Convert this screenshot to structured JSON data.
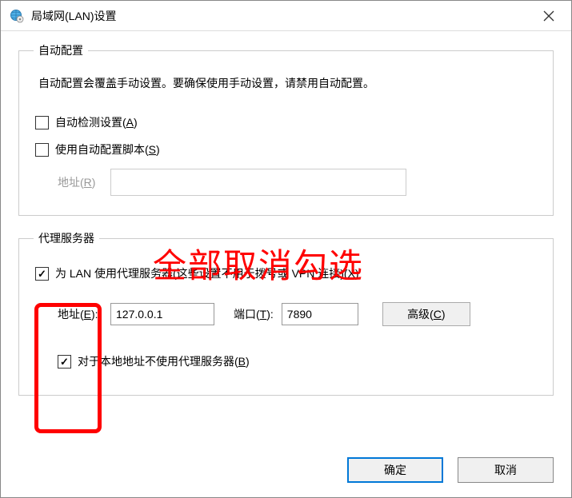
{
  "window": {
    "title": "局域网(LAN)设置"
  },
  "auto_config": {
    "legend": "自动配置",
    "description": "自动配置会覆盖手动设置。要确保使用手动设置，请禁用自动配置。",
    "auto_detect_label": "自动检测设置(A)",
    "auto_detect_checked": false,
    "use_script_label": "使用自动配置脚本(S)",
    "use_script_checked": false,
    "address_label": "地址(R)",
    "address_value": ""
  },
  "proxy": {
    "legend": "代理服务器",
    "use_proxy_label": "为 LAN 使用代理服务器(这些设置不用于拨号或 VPN 连接)(X)",
    "use_proxy_checked": true,
    "address_label": "地址(E):",
    "address_value": "127.0.0.1",
    "port_label": "端口(T):",
    "port_value": "7890",
    "advanced_label": "高级(C)",
    "bypass_local_label": "对于本地地址不使用代理服务器(B)",
    "bypass_local_checked": true
  },
  "buttons": {
    "ok": "确定",
    "cancel": "取消"
  },
  "annotation": {
    "text": "全部取消勾选"
  }
}
